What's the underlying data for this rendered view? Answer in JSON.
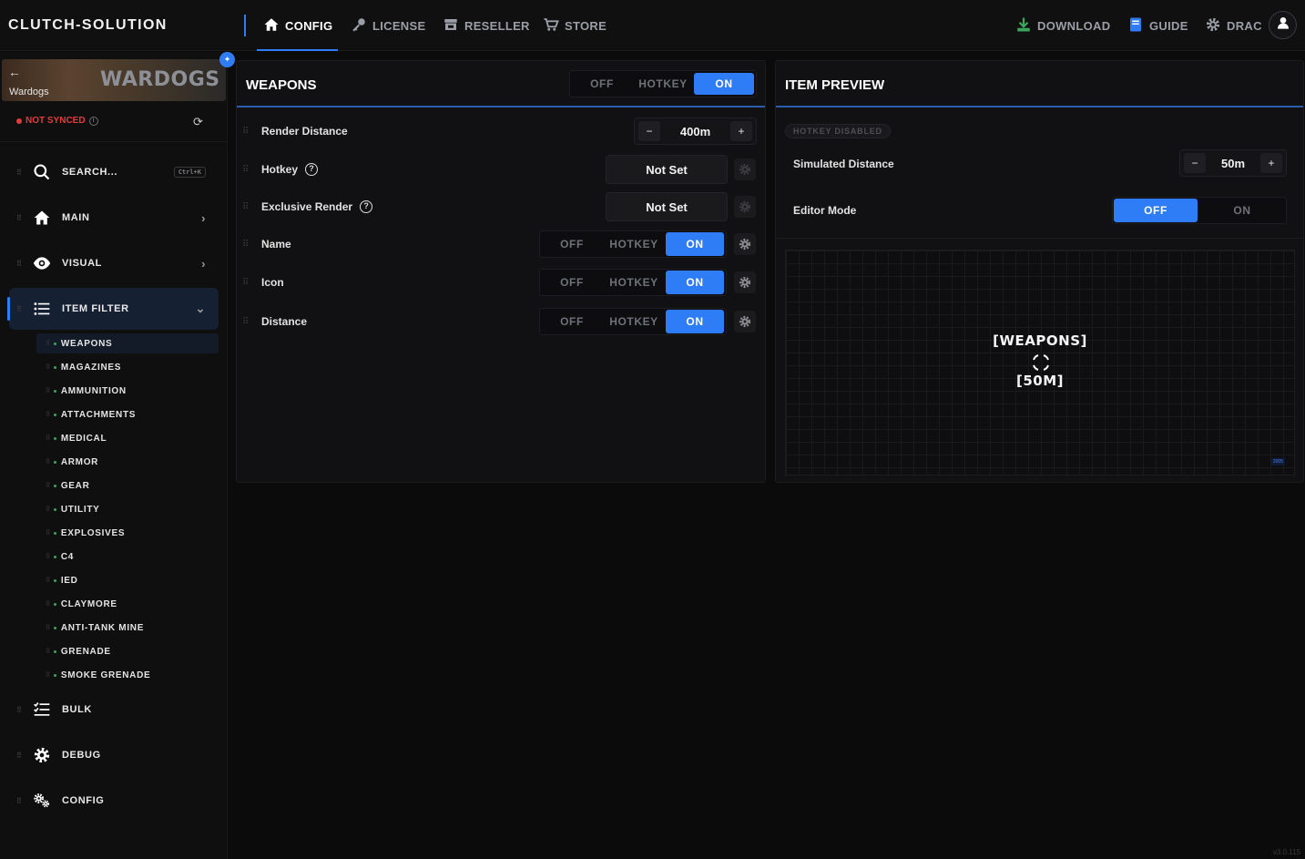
{
  "app": {
    "brand": "CLUTCH-SOLUTION",
    "version": "v3.0.115"
  },
  "nav": {
    "tabs": [
      {
        "label": "CONFIG",
        "icon": "home-icon",
        "active": true
      },
      {
        "label": "LICENSE",
        "icon": "key-icon"
      },
      {
        "label": "RESELLER",
        "icon": "store-icon"
      },
      {
        "label": "STORE",
        "icon": "cart-icon"
      }
    ],
    "right": [
      {
        "label": "DOWNLOAD",
        "icon": "download-icon"
      },
      {
        "label": "GUIDE",
        "icon": "book-icon"
      },
      {
        "label": "DRAC",
        "icon": "gear-icon"
      }
    ]
  },
  "sidebar": {
    "game": {
      "name": "Wardogs",
      "logo_text": "WARDOGS"
    },
    "sync_status": "NOT SYNCED",
    "search": {
      "label": "SEARCH...",
      "shortcut": "Ctrl+K"
    },
    "items": [
      {
        "label": "MAIN"
      },
      {
        "label": "VISUAL"
      },
      {
        "label": "ITEM FILTER"
      },
      {
        "label": "BULK"
      },
      {
        "label": "DEBUG"
      },
      {
        "label": "CONFIG"
      }
    ],
    "subitems": [
      "WEAPONS",
      "MAGAZINES",
      "AMMUNITION",
      "ATTACHMENTS",
      "MEDICAL",
      "ARMOR",
      "GEAR",
      "UTILITY",
      "EXPLOSIVES",
      "C4",
      "IED",
      "CLAYMORE",
      "ANTI-TANK MINE",
      "GRENADE",
      "SMOKE GRENADE"
    ]
  },
  "weapons_panel": {
    "title": "WEAPONS",
    "toggle": {
      "off": "OFF",
      "hotkey": "HOTKEY",
      "on": "ON",
      "selected": "ON"
    },
    "rows": {
      "render_distance": {
        "label": "Render Distance",
        "value": "400m",
        "minus": "−",
        "plus": "+"
      },
      "hotkey": {
        "label": "Hotkey",
        "value": "Not Set"
      },
      "exclusive_render": {
        "label": "Exclusive Render",
        "value": "Not Set"
      },
      "name": {
        "label": "Name",
        "off": "OFF",
        "hotkey": "HOTKEY",
        "on": "ON"
      },
      "icon": {
        "label": "Icon",
        "off": "OFF",
        "hotkey": "HOTKEY",
        "on": "ON"
      },
      "distance": {
        "label": "Distance",
        "off": "OFF",
        "hotkey": "HOTKEY",
        "on": "ON"
      }
    }
  },
  "preview_panel": {
    "title": "ITEM PREVIEW",
    "hotkey_badge": "HOTKEY DISABLED",
    "simulated_distance": {
      "label": "Simulated Distance",
      "value": "50m",
      "minus": "−",
      "plus": "+"
    },
    "editor_mode": {
      "label": "Editor Mode",
      "off": "OFF",
      "on": "ON",
      "selected": "OFF"
    },
    "preview": {
      "name": "[WEAPONS]",
      "distance": "[50M]",
      "badge": "2005"
    }
  },
  "colors": {
    "accent": "#2f7df6",
    "danger": "#e23b3b",
    "download": "#3ba55c",
    "background": "#0b0b0c"
  }
}
